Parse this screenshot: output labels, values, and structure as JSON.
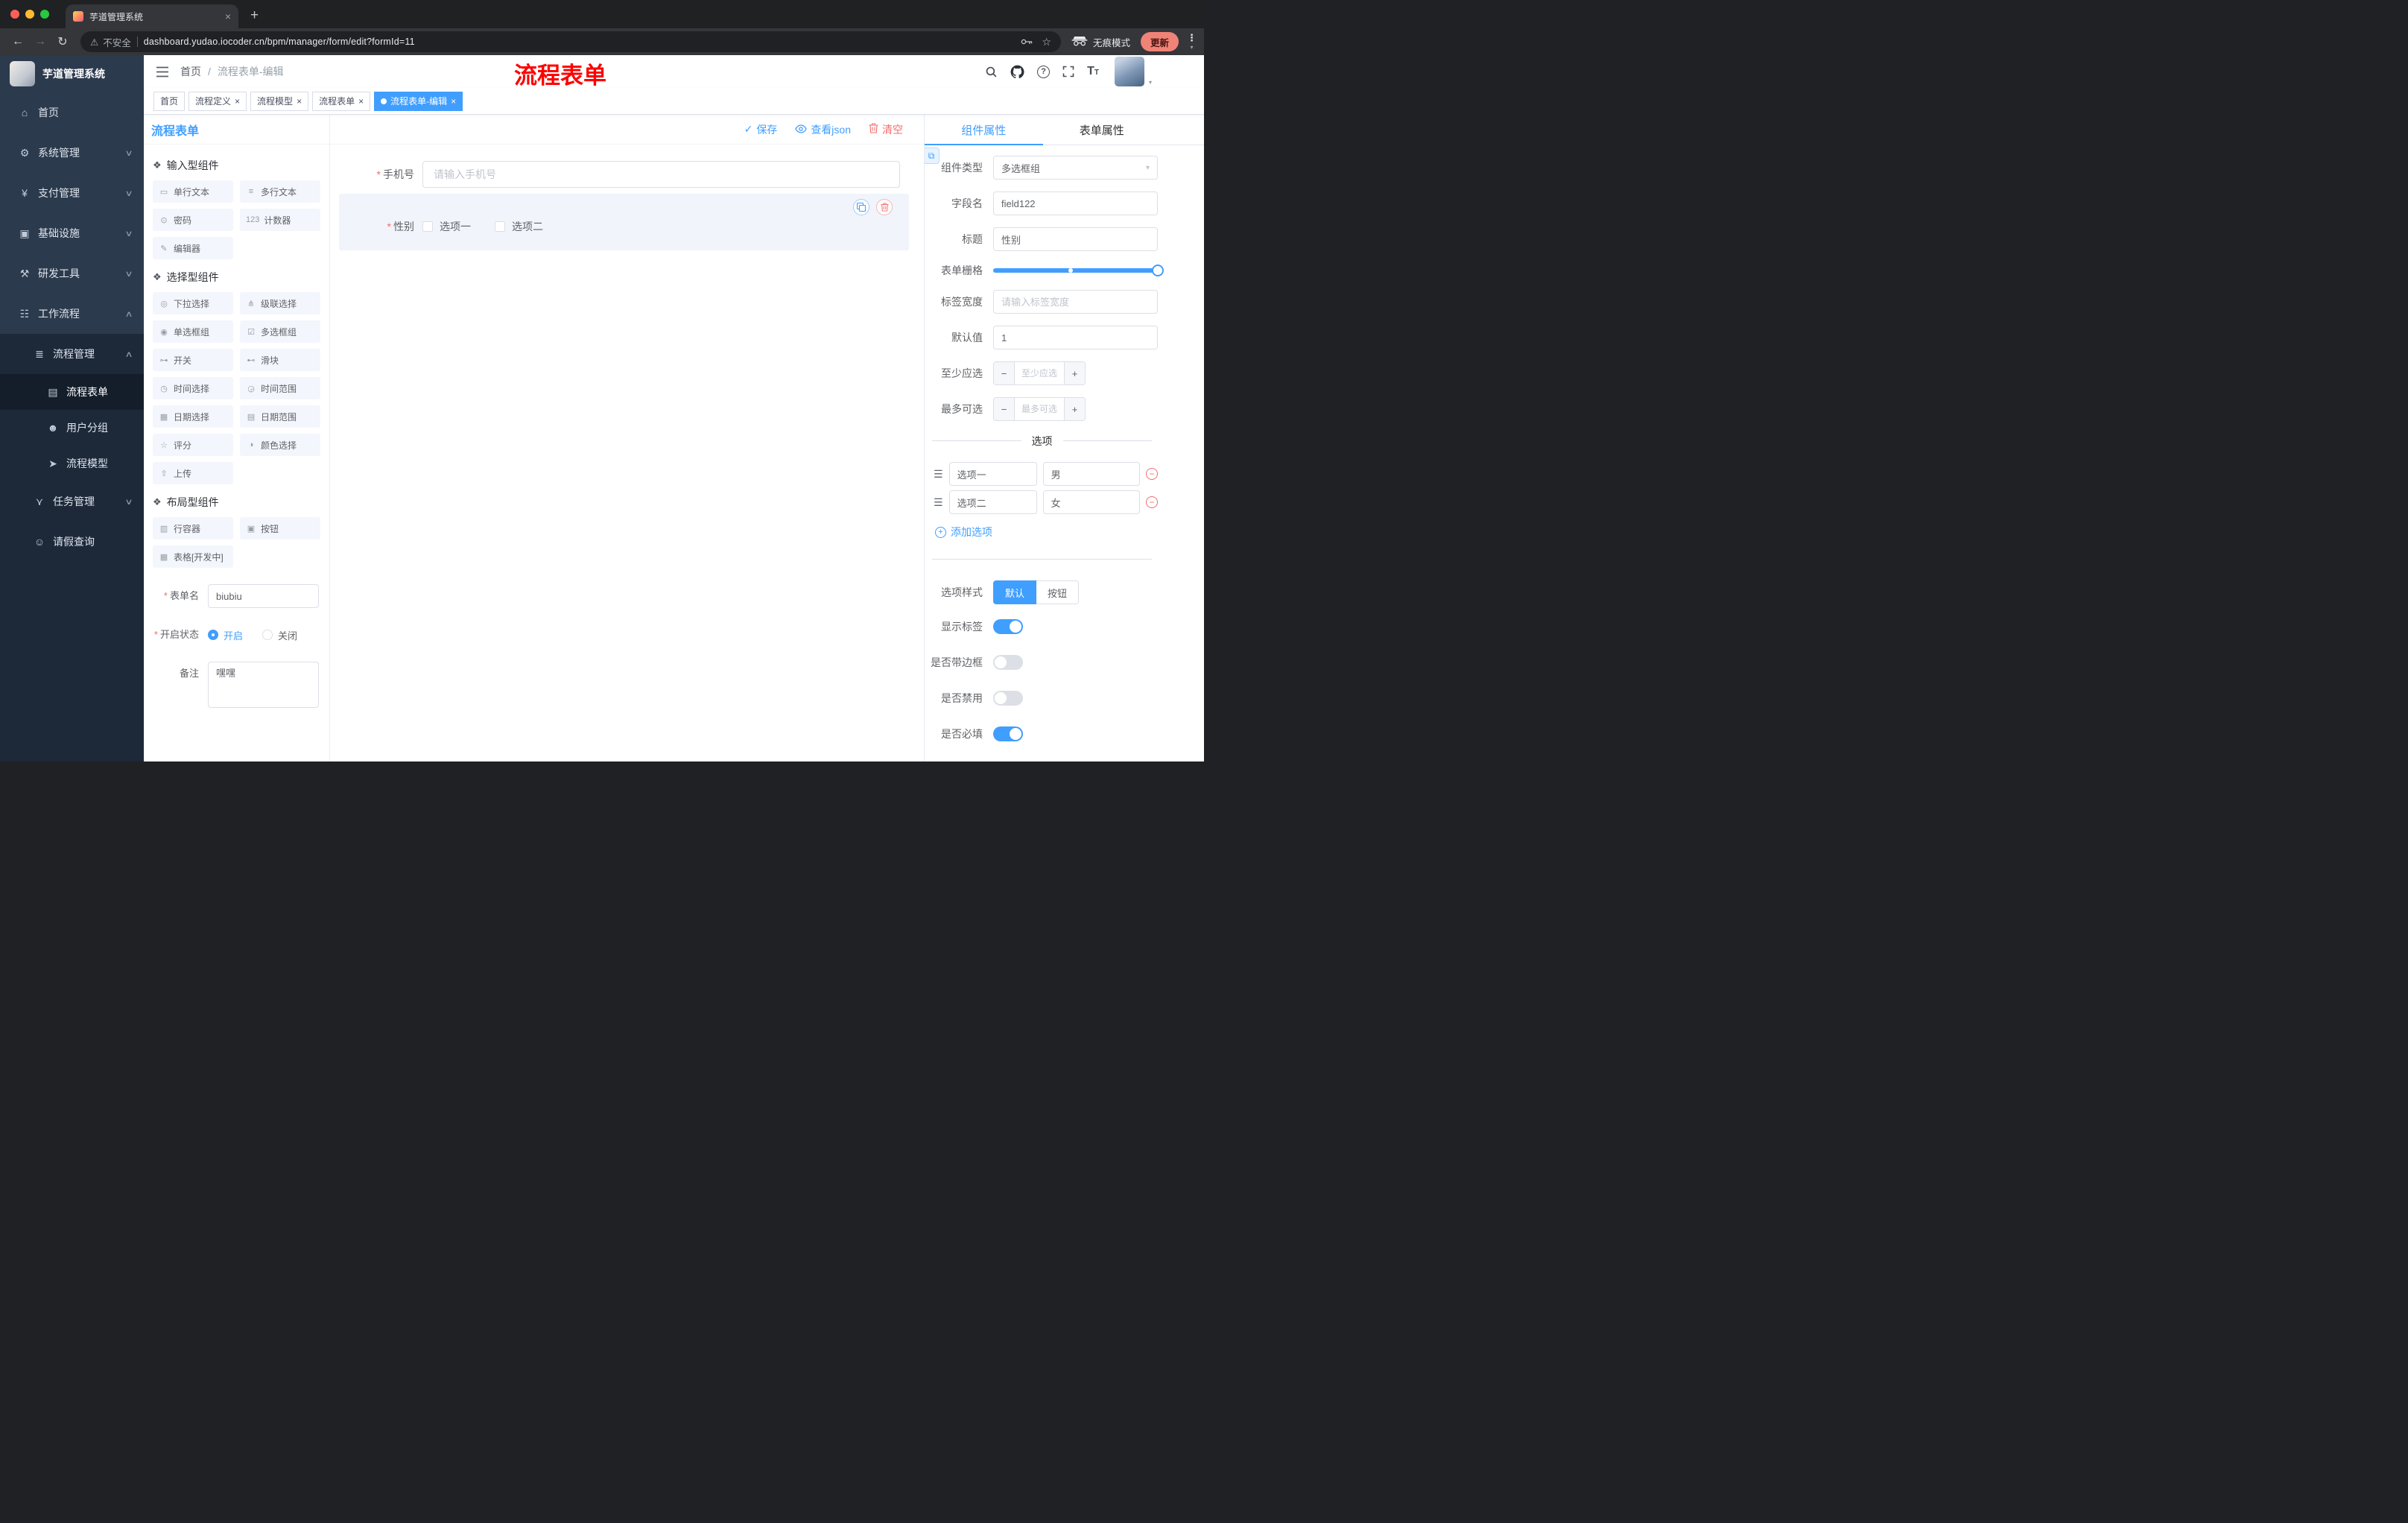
{
  "accent": "#409eff",
  "danger": "#f56c6c",
  "icons": {
    "close": "×",
    "new_tab": "+",
    "back": "←",
    "forward": "→",
    "reload": "↻",
    "warning": "⚠",
    "star": "☆",
    "dots": "⋮",
    "caret": "▾",
    "check": "✓",
    "question": "?",
    "group": "❖",
    "handle": "☰",
    "minus": "−",
    "plus": "+",
    "link": "⧉",
    "breadcrumb_sep": "/",
    "font_size_main": "T",
    "font_size_sub": "T"
  },
  "browser": {
    "tab_title": "芋道管理系统",
    "security_label": "不安全",
    "url": "dashboard.yudao.iocoder.cn/bpm/manager/form/edit?formId=11",
    "incognito_label": "无痕模式",
    "update_label": "更新"
  },
  "sidebar": {
    "logo_text": "芋道管理系统",
    "menu": [
      {
        "name": "home",
        "label": "首页",
        "icon": "⌂",
        "level": 1
      },
      {
        "name": "system-management",
        "label": "系统管理",
        "icon": "⚙",
        "level": 1,
        "chevron": "down"
      },
      {
        "name": "payment-management",
        "label": "支付管理",
        "icon": "¥",
        "level": 1,
        "chevron": "down"
      },
      {
        "name": "infrastructure",
        "label": "基础设施",
        "icon": "▣",
        "level": 1,
        "chevron": "down"
      },
      {
        "name": "dev-tools",
        "label": "研发工具",
        "icon": "⚒",
        "level": 1,
        "chevron": "down"
      },
      {
        "name": "workflow",
        "label": "工作流程",
        "icon": "☷",
        "level": 1,
        "chevron": "up"
      },
      {
        "name": "process-management",
        "label": "流程管理",
        "icon": "≣",
        "level": 2,
        "chevron": "up"
      },
      {
        "name": "process-form",
        "label": "流程表单",
        "icon": "▤",
        "level": 3,
        "active": true
      },
      {
        "name": "user-group",
        "label": "用户分组",
        "icon": "☻",
        "level": 3
      },
      {
        "name": "process-model",
        "label": "流程模型",
        "icon": "➤",
        "level": 3
      },
      {
        "name": "task-management",
        "label": "任务管理",
        "icon": "⋎",
        "level": 2,
        "chevron": "down"
      },
      {
        "name": "leave-query",
        "label": "请假查询",
        "icon": "☺",
        "level": 2
      }
    ]
  },
  "header": {
    "breadcrumb_home": "首页",
    "breadcrumb_current": "流程表单-编辑",
    "annotation": "流程表单"
  },
  "tags": [
    {
      "name": "home",
      "label": "首页",
      "closable": false,
      "active": false
    },
    {
      "name": "process-definition",
      "label": "流程定义",
      "closable": true,
      "active": false
    },
    {
      "name": "process-model",
      "label": "流程模型",
      "closable": true,
      "active": false
    },
    {
      "name": "process-form",
      "label": "流程表单",
      "closable": true,
      "active": false
    },
    {
      "name": "process-form-edit",
      "label": "流程表单-编辑",
      "closable": true,
      "active": true
    }
  ],
  "designer": {
    "panel_title": "流程表单",
    "toolbar": {
      "save": "保存",
      "view_json": "查看json",
      "clear": "清空"
    },
    "palette_groups": [
      {
        "title": "输入型组件",
        "items": [
          {
            "label": "单行文本",
            "icon": "▭"
          },
          {
            "label": "多行文本",
            "icon": "≡"
          },
          {
            "label": "密码",
            "icon": "⊙"
          },
          {
            "label": "计数器",
            "icon": "123"
          },
          {
            "label": "编辑器",
            "icon": "✎"
          }
        ]
      },
      {
        "title": "选择型组件",
        "items": [
          {
            "label": "下拉选择",
            "icon": "◎"
          },
          {
            "label": "级联选择",
            "icon": "⋔"
          },
          {
            "label": "单选框组",
            "icon": "◉"
          },
          {
            "label": "多选框组",
            "icon": "☑"
          },
          {
            "label": "开关",
            "icon": "⊶"
          },
          {
            "label": "滑块",
            "icon": "⊷"
          },
          {
            "label": "时间选择",
            "icon": "◷"
          },
          {
            "label": "时间范围",
            "icon": "◶"
          },
          {
            "label": "日期选择",
            "icon": "▦"
          },
          {
            "label": "日期范围",
            "icon": "▤"
          },
          {
            "label": "评分",
            "icon": "☆"
          },
          {
            "label": "颜色选择",
            "icon": "◑"
          },
          {
            "label": "上传",
            "icon": "⇧"
          }
        ]
      },
      {
        "title": "布局型组件",
        "items": [
          {
            "label": "行容器",
            "icon": "▥"
          },
          {
            "label": "按钮",
            "icon": "▣"
          },
          {
            "label": "表格[开发中]",
            "icon": "▦"
          }
        ]
      }
    ],
    "meta_form": {
      "name_label": "表单名",
      "name_value": "biubiu",
      "status_label": "开启状态",
      "status_on": "开启",
      "status_off": "关闭",
      "remark_label": "备注",
      "remark_value": "嘿嘿"
    },
    "canvas": {
      "phone_label": "手机号",
      "phone_placeholder": "请输入手机号",
      "gender_label": "性别",
      "gender_options": [
        "选项一",
        "选项二"
      ]
    },
    "props": {
      "tab_component": "组件属性",
      "tab_form": "表单属性",
      "component_type_label": "组件类型",
      "component_type_value": "多选框组",
      "field_name_label": "字段名",
      "field_name_value": "field122",
      "title_label": "标题",
      "title_value": "性别",
      "grid_label": "表单栅格",
      "label_width_label": "标签宽度",
      "label_width_placeholder": "请输入标签宽度",
      "default_label": "默认值",
      "default_value": "1",
      "min_label": "至少应选",
      "min_placeholder": "至少应选",
      "max_label": "最多可选",
      "max_placeholder": "最多可选",
      "options_title": "选项",
      "options": [
        {
          "label": "选项一",
          "value": "男"
        },
        {
          "label": "选项二",
          "value": "女"
        }
      ],
      "add_option": "添加选项",
      "style_label": "选项样式",
      "style_options": [
        "默认",
        "按钮"
      ],
      "style_active": "默认",
      "switches": [
        {
          "name": "show-label",
          "label": "显示标签",
          "on": true
        },
        {
          "name": "with-border",
          "label": "是否带边框",
          "on": false
        },
        {
          "name": "disabled",
          "label": "是否禁用",
          "on": false
        },
        {
          "name": "required",
          "label": "是否必填",
          "on": true
        }
      ]
    }
  }
}
